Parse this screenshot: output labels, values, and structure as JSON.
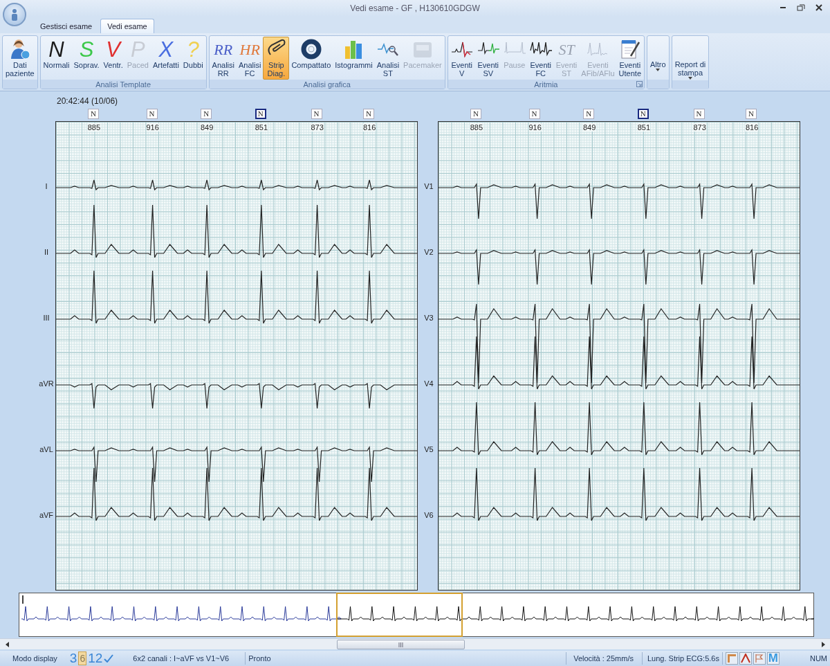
{
  "window": {
    "title": "Vedi esame  -  GF , H130610GDGW"
  },
  "tabs": [
    {
      "label": "Gestisci esame",
      "selected": false
    },
    {
      "label": "Vedi esame",
      "selected": true
    }
  ],
  "ribbon": {
    "groups": [
      {
        "buttons": [
          {
            "label": "Dati\npaziente",
            "kind": "icon",
            "disabled": false,
            "selected": false
          }
        ]
      },
      {
        "title": "Analisi Template",
        "buttons": [
          {
            "label": "Normali",
            "kind": "glyph",
            "glyph": "N",
            "color": "#1c1c1c",
            "disabled": false,
            "selected": false
          },
          {
            "label": "Soprav.",
            "kind": "glyph",
            "glyph": "S",
            "color": "#3cc84a",
            "disabled": false,
            "selected": false
          },
          {
            "label": "Ventr.",
            "kind": "glyph",
            "glyph": "V",
            "color": "#e03030",
            "disabled": false,
            "selected": false
          },
          {
            "label": "Paced",
            "kind": "glyph",
            "glyph": "P",
            "color": "#c8ccd4",
            "disabled": true,
            "selected": false
          },
          {
            "label": "Artefatti",
            "kind": "glyph",
            "glyph": "X",
            "color": "#4a6ee0",
            "disabled": false,
            "selected": false
          },
          {
            "label": "Dubbi",
            "kind": "glyph",
            "glyph": "?",
            "color": "#f0d050",
            "disabled": false,
            "selected": false
          }
        ]
      },
      {
        "title": "Analisi grafica",
        "buttons": [
          {
            "label": "Analisi\nRR",
            "kind": "serif",
            "glyph": "RR",
            "color": "#4a5ec8",
            "disabled": false,
            "selected": false
          },
          {
            "label": "Analisi\nFC",
            "kind": "serif",
            "glyph": "HR",
            "color": "#e0783a",
            "disabled": false,
            "selected": false
          },
          {
            "label": "Strip\nDiag.",
            "kind": "icon",
            "disabled": false,
            "selected": true
          },
          {
            "label": "Compattato",
            "kind": "icon",
            "disabled": false,
            "selected": false
          },
          {
            "label": "Istogrammi",
            "kind": "icon",
            "disabled": false,
            "selected": false
          },
          {
            "label": "Analisi\nST",
            "kind": "icon",
            "disabled": false,
            "selected": false
          },
          {
            "label": "Pacemaker",
            "kind": "icon",
            "disabled": true,
            "selected": false
          }
        ]
      },
      {
        "title": "Aritmia",
        "launcher": true,
        "buttons": [
          {
            "label": "Eventi\nV",
            "kind": "icon",
            "disabled": false,
            "selected": false
          },
          {
            "label": "Eventi\nSV",
            "kind": "icon",
            "disabled": false,
            "selected": false
          },
          {
            "label": "Pause",
            "kind": "icon",
            "disabled": true,
            "selected": false
          },
          {
            "label": "Eventi\nFC",
            "kind": "icon",
            "disabled": false,
            "selected": false
          },
          {
            "label": "Eventi\nST",
            "kind": "serif",
            "glyph": "ST",
            "color": "#9aa2b0",
            "disabled": true,
            "selected": false
          },
          {
            "label": "Eventi\nAFib/AFlu",
            "kind": "icon",
            "disabled": true,
            "selected": false
          },
          {
            "label": "Eventi\nUtente",
            "kind": "icon",
            "disabled": false,
            "selected": false
          }
        ]
      },
      {
        "buttons": [
          {
            "label": "Altro",
            "kind": "dropdown",
            "disabled": false,
            "selected": false
          }
        ]
      },
      {
        "buttons": [
          {
            "label": "Report di\nstampa",
            "kind": "dropdown",
            "disabled": false,
            "selected": false
          }
        ]
      }
    ]
  },
  "ecg": {
    "timestamp": "20:42:44 (10/06)",
    "panels": [
      {
        "beats": [
          {
            "label": "N",
            "interval": "885",
            "selected": false
          },
          {
            "label": "N",
            "interval": "916",
            "selected": false
          },
          {
            "label": "N",
            "interval": "849",
            "selected": false
          },
          {
            "label": "N",
            "interval": "851",
            "selected": true
          },
          {
            "label": "N",
            "interval": "873",
            "selected": false
          },
          {
            "label": "N",
            "interval": "816",
            "selected": false
          }
        ],
        "leads": [
          {
            "name": "I",
            "kind": "low"
          },
          {
            "name": "II",
            "kind": "tall"
          },
          {
            "name": "III",
            "kind": "tall"
          },
          {
            "name": "aVR",
            "kind": "inverted"
          },
          {
            "name": "aVL",
            "kind": "deep"
          },
          {
            "name": "aVF",
            "kind": "tall"
          }
        ]
      },
      {
        "beats": [
          {
            "label": "N",
            "interval": "885",
            "selected": false
          },
          {
            "label": "N",
            "interval": "916",
            "selected": false
          },
          {
            "label": "N",
            "interval": "849",
            "selected": false
          },
          {
            "label": "N",
            "interval": "851",
            "selected": true
          },
          {
            "label": "N",
            "interval": "873",
            "selected": false
          },
          {
            "label": "N",
            "interval": "816",
            "selected": false
          }
        ],
        "leads": [
          {
            "name": "V1",
            "kind": "deep"
          },
          {
            "name": "V2",
            "kind": "deep"
          },
          {
            "name": "V3",
            "kind": "biphasic"
          },
          {
            "name": "V4",
            "kind": "tall"
          },
          {
            "name": "V5",
            "kind": "tall"
          },
          {
            "name": "V6",
            "kind": "tall"
          }
        ]
      }
    ]
  },
  "status_bar": {
    "mode_label": "Modo display",
    "modes": [
      {
        "label": "3",
        "selected": false
      },
      {
        "label": "6",
        "selected": true
      },
      {
        "label": "12",
        "selected": false
      }
    ],
    "channels": "6x2 canali : I~aVF vs V1~V6",
    "state": "Pronto",
    "speed": "Velocità : 25mm/s",
    "strip_length": "Lung. Strip ECG:5.6s",
    "icon_letter": "M",
    "num": "NUM"
  }
}
